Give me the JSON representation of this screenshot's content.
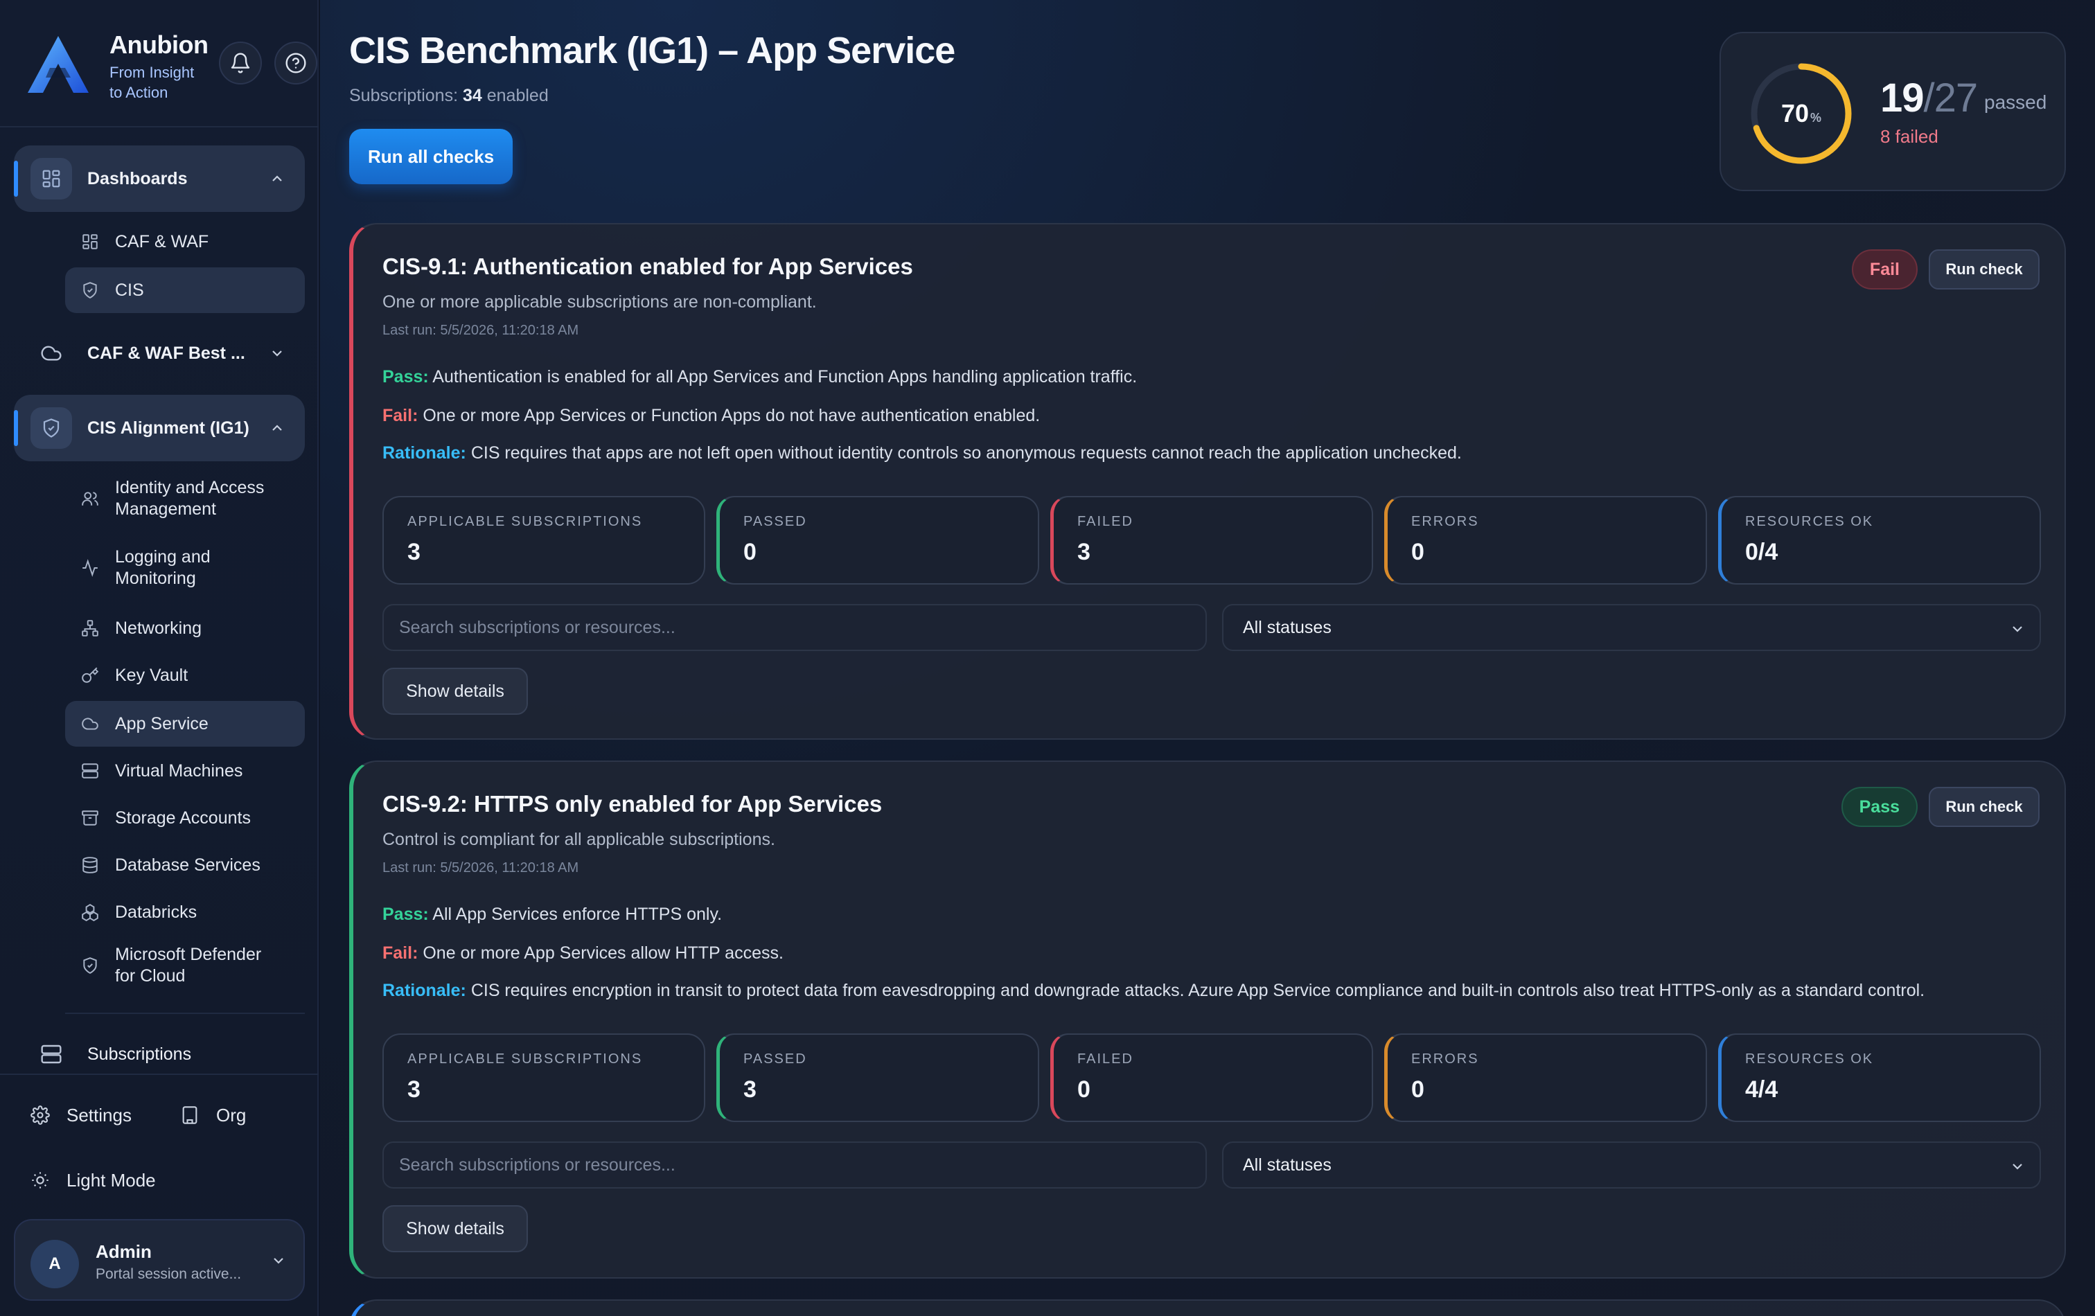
{
  "brand": {
    "name": "Anubion",
    "tagline_1": "From Insight",
    "tagline_2": "to Action"
  },
  "sidebar": {
    "groups": [
      {
        "label": "Dashboards",
        "icon": "grid-icon",
        "expanded": true
      },
      {
        "label": "CAF & WAF Best ...",
        "icon": "cloud-icon",
        "expanded": false
      },
      {
        "label": "CIS Alignment (IG1)",
        "icon": "shield-icon",
        "expanded": true
      },
      {
        "label": "Subscriptions",
        "icon": "server-icon"
      }
    ],
    "dashboard_items": [
      {
        "label": "CAF & WAF",
        "icon": "grid-icon"
      },
      {
        "label": "CIS",
        "icon": "shield-icon",
        "active": true
      }
    ],
    "cis_items": [
      {
        "label": "Identity and Access Management",
        "icon": "users-icon"
      },
      {
        "label": "Logging and Monitoring",
        "icon": "activity-icon"
      },
      {
        "label": "Networking",
        "icon": "network-icon"
      },
      {
        "label": "Key Vault",
        "icon": "key-icon"
      },
      {
        "label": "App Service",
        "icon": "cloud-icon",
        "active": true
      },
      {
        "label": "Virtual Machines",
        "icon": "server-icon"
      },
      {
        "label": "Storage Accounts",
        "icon": "archive-icon"
      },
      {
        "label": "Database Services",
        "icon": "database-icon"
      },
      {
        "label": "Databricks",
        "icon": "boxes-icon"
      },
      {
        "label": "Microsoft Defender for Cloud",
        "icon": "shield-icon"
      }
    ],
    "settings_label": "Settings",
    "org_label": "Org",
    "theme_label": "Light Mode",
    "user": {
      "initial": "A",
      "name": "Admin",
      "status": "Portal session active..."
    }
  },
  "header": {
    "title": "CIS Benchmark (IG1) – App Service",
    "subscriptions_label": "Subscriptions:",
    "subscriptions_count": "34",
    "subscriptions_suffix": "enabled",
    "run_all_label": "Run all checks"
  },
  "score": {
    "percent": 70,
    "percent_label": "70",
    "percent_unit": "%",
    "passed": "19",
    "total": "/27",
    "passed_label": "passed",
    "failed_text": "8 failed",
    "ring_color": "#f5b82e"
  },
  "checks": [
    {
      "title": "CIS-9.1: Authentication enabled for App Services",
      "summary": "One or more applicable subscriptions are non-compliant.",
      "last_run": "Last run: 5/5/2026, 11:20:18 AM",
      "status": "Fail",
      "run_label": "Run check",
      "pass_label": "Pass:",
      "pass_text": "Authentication is enabled for all App Services and Function Apps handling application traffic.",
      "fail_label": "Fail:",
      "fail_text": "One or more App Services or Function Apps do not have authentication enabled.",
      "rationale_label": "Rationale:",
      "rationale_text": "CIS requires that apps are not left open without identity controls so anonymous requests cannot reach the application unchecked.",
      "metrics": [
        {
          "label": "APPLICABLE SUBSCRIPTIONS",
          "value": "3"
        },
        {
          "label": "PASSED",
          "value": "0"
        },
        {
          "label": "FAILED",
          "value": "3"
        },
        {
          "label": "ERRORS",
          "value": "0"
        },
        {
          "label": "RESOURCES OK",
          "value": "0/4"
        }
      ],
      "search_placeholder": "Search subscriptions or resources...",
      "status_filter": "All statuses",
      "details_label": "Show details"
    },
    {
      "title": "CIS-9.2: HTTPS only enabled for App Services",
      "summary": "Control is compliant for all applicable subscriptions.",
      "last_run": "Last run: 5/5/2026, 11:20:18 AM",
      "status": "Pass",
      "run_label": "Run check",
      "pass_label": "Pass:",
      "pass_text": "All App Services enforce HTTPS only.",
      "fail_label": "Fail:",
      "fail_text": "One or more App Services allow HTTP access.",
      "rationale_label": "Rationale:",
      "rationale_text": "CIS requires encryption in transit to protect data from eavesdropping and downgrade attacks. Azure App Service compliance and built-in controls also treat HTTPS-only as a standard control.",
      "metrics": [
        {
          "label": "APPLICABLE SUBSCRIPTIONS",
          "value": "3"
        },
        {
          "label": "PASSED",
          "value": "3"
        },
        {
          "label": "FAILED",
          "value": "0"
        },
        {
          "label": "ERRORS",
          "value": "0"
        },
        {
          "label": "RESOURCES OK",
          "value": "4/4"
        }
      ],
      "search_placeholder": "Search subscriptions or resources...",
      "status_filter": "All statuses",
      "details_label": "Show details"
    }
  ]
}
